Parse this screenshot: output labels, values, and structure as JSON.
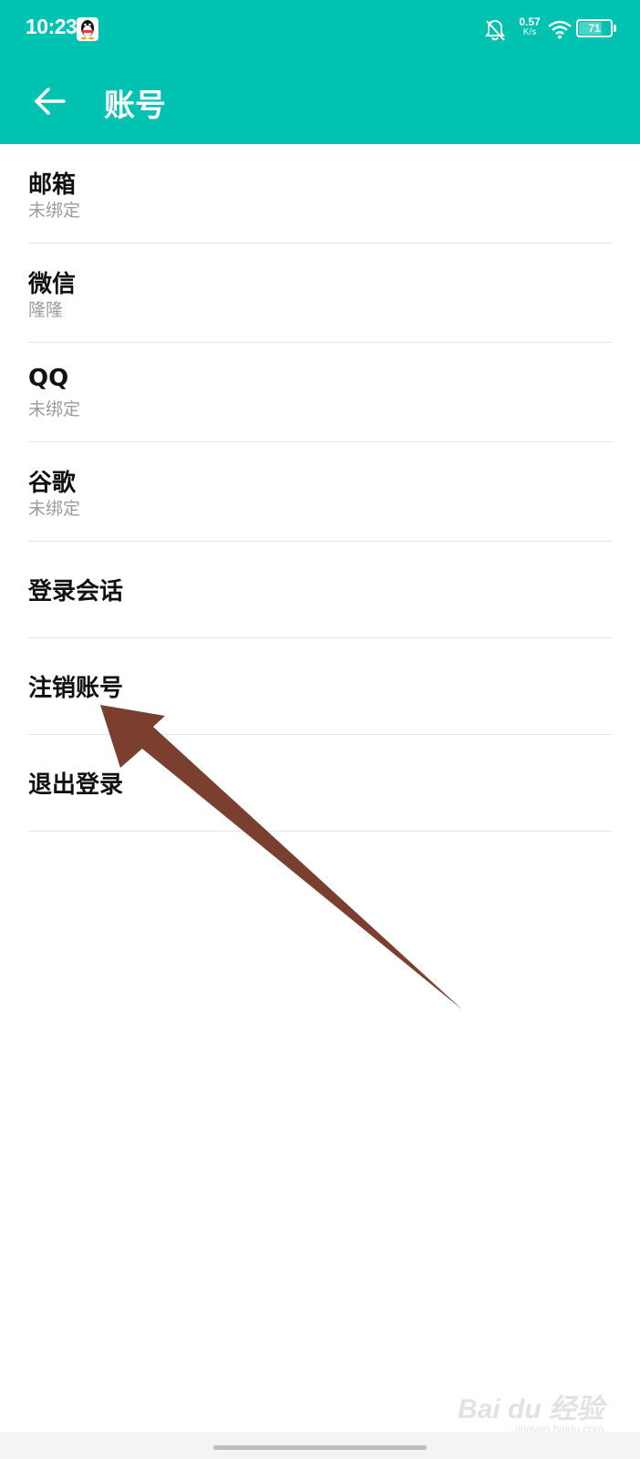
{
  "colors": {
    "accent": "#00c2b0",
    "title_text": "#111111",
    "subtitle_text": "#9b9b9b",
    "divider": "#e6e6e6",
    "arrow": "#7a3f2f"
  },
  "status_bar": {
    "time": "10:23",
    "net_speed_value": "0.57",
    "net_speed_unit": "K/s",
    "battery_level": "71",
    "icons": [
      "qq-icon",
      "bell-off-icon",
      "wifi-icon",
      "battery-icon"
    ]
  },
  "header": {
    "title": "账号",
    "back_icon": "arrow-left-icon"
  },
  "items": [
    {
      "title": "邮箱",
      "subtitle": "未绑定"
    },
    {
      "title": "微信",
      "subtitle": "隆隆"
    },
    {
      "title": "QQ",
      "subtitle": "未绑定"
    },
    {
      "title": "谷歌",
      "subtitle": "未绑定"
    },
    {
      "title": "登录会话"
    },
    {
      "title": "注销账号"
    },
    {
      "title": "退出登录"
    }
  ],
  "watermark": {
    "brand": "Bai du 经验",
    "url": "jingyan.baidu.com"
  }
}
